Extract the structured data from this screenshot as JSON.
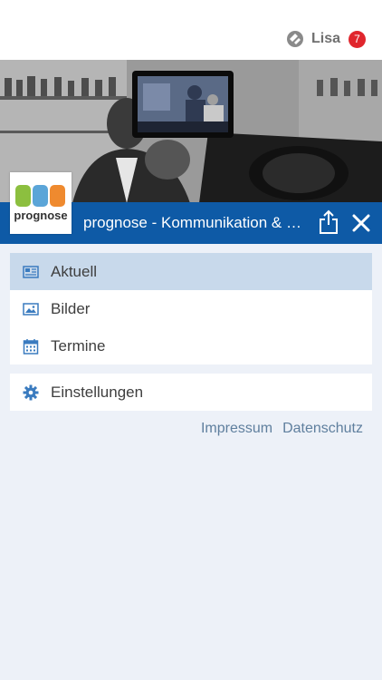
{
  "header": {
    "username": "Lisa",
    "notification_count": "7"
  },
  "channel": {
    "title": "prognose - Kommunikation & Medien"
  },
  "menu": {
    "items": [
      {
        "label": "Aktuell",
        "icon": "newspaper-icon",
        "active": true
      },
      {
        "label": "Bilder",
        "icon": "image-icon",
        "active": false
      },
      {
        "label": "Termine",
        "icon": "calendar-icon",
        "active": false
      }
    ],
    "settings": {
      "label": "Einstellungen",
      "icon": "gear-icon"
    }
  },
  "footer": {
    "impressum": "Impressum",
    "datenschutz": "Datenschutz"
  },
  "logo": {
    "text": "prognose"
  },
  "colors": {
    "accent": "#0e5aa6",
    "badge": "#e0262d",
    "active_row": "#c8d9eb",
    "background": "#edf1f8",
    "link": "#5f7f9e"
  }
}
